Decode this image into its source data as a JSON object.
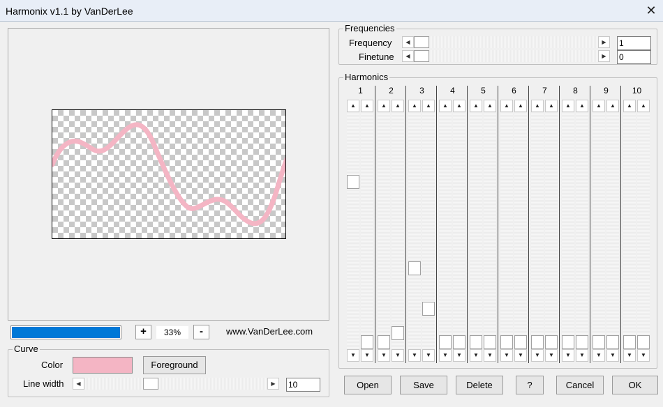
{
  "window": {
    "title": "Harmonix v1.1 by VanDerLee",
    "close_icon": "close-icon"
  },
  "preview": {
    "progress_fraction": 1.0,
    "zoom_out_label": "+",
    "zoom_value": "33%",
    "zoom_in_label": "-",
    "website": "www.VanDerLee.com",
    "curve_color": "#f4b5c4",
    "accent_color": "#0078d7"
  },
  "curve": {
    "legend": "Curve",
    "color_label": "Color",
    "color_value": "#f4b5c4",
    "foreground_label": "Foreground",
    "line_width_label": "Line width",
    "line_width_value": "10",
    "line_width_fraction": 0.35
  },
  "frequencies": {
    "legend": "Frequencies",
    "frequency_label": "Frequency",
    "frequency_value": "1",
    "frequency_fraction": 0.0,
    "finetune_label": "Finetune",
    "finetune_value": "0",
    "finetune_fraction": 0.0
  },
  "harmonics": {
    "legend": "Harmonics",
    "columns": [
      {
        "label": "1",
        "left": 0.72,
        "right": 0.0
      },
      {
        "label": "2",
        "left": 0.0,
        "right": 0.04
      },
      {
        "label": "3",
        "left": 0.33,
        "right": 0.15
      },
      {
        "label": "4",
        "left": 0.0,
        "right": 0.0
      },
      {
        "label": "5",
        "left": 0.0,
        "right": 0.0
      },
      {
        "label": "6",
        "left": 0.0,
        "right": 0.0
      },
      {
        "label": "7",
        "left": 0.0,
        "right": 0.0
      },
      {
        "label": "8",
        "left": 0.0,
        "right": 0.0
      },
      {
        "label": "9",
        "left": 0.0,
        "right": 0.0
      },
      {
        "label": "10",
        "left": 0.0,
        "right": 0.0
      }
    ]
  },
  "buttons": {
    "open": "Open",
    "save": "Save",
    "delete": "Delete",
    "help": "?",
    "cancel": "Cancel",
    "ok": "OK"
  }
}
